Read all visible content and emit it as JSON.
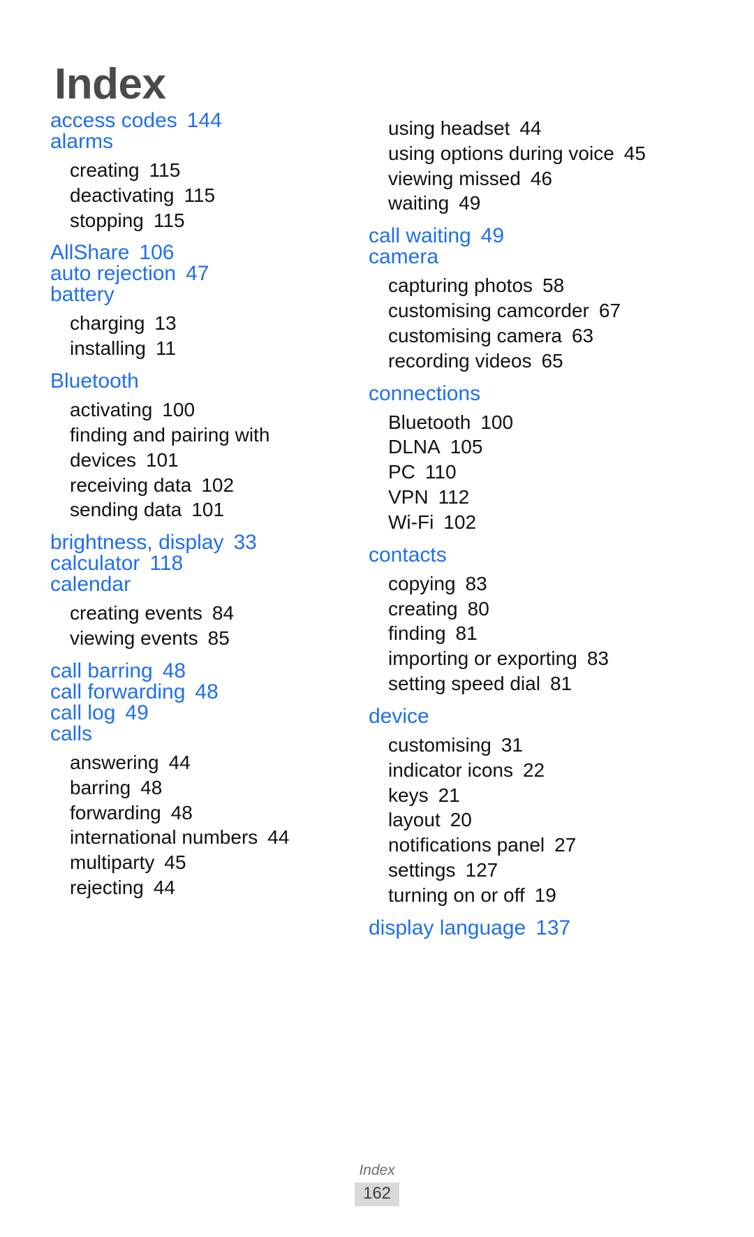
{
  "page": {
    "title": "Index",
    "footer_label": "Index",
    "footer_page_number": "162",
    "accent_color": "#1f6fec",
    "title_color": "#4a4a4a",
    "body_color": "#111111",
    "footer_badge_color": "#d9d9d9"
  },
  "columns": [
    {
      "id": "left",
      "groups": [
        {
          "heading": "access codes",
          "heading_page": "144",
          "subentries": []
        },
        {
          "heading": "alarms",
          "heading_page": "",
          "subentries": [
            {
              "label": "creating",
              "page": "115"
            },
            {
              "label": "deactivating",
              "page": "115"
            },
            {
              "label": "stopping",
              "page": "115"
            }
          ]
        },
        {
          "heading": "AllShare",
          "heading_page": "106",
          "subentries": []
        },
        {
          "heading": "auto rejection",
          "heading_page": "47",
          "subentries": []
        },
        {
          "heading": "battery",
          "heading_page": "",
          "subentries": [
            {
              "label": "charging",
              "page": "13"
            },
            {
              "label": "installing",
              "page": "11"
            }
          ]
        },
        {
          "heading": "Bluetooth",
          "heading_page": "",
          "subentries": [
            {
              "label": "activating",
              "page": "100"
            },
            {
              "label": "finding and pairing with devices",
              "page": "101",
              "wrap": true
            },
            {
              "label": "receiving data",
              "page": "102"
            },
            {
              "label": "sending data",
              "page": "101"
            }
          ]
        },
        {
          "heading": "brightness, display",
          "heading_page": "33",
          "subentries": []
        },
        {
          "heading": "calculator",
          "heading_page": "118",
          "subentries": []
        },
        {
          "heading": "calendar",
          "heading_page": "",
          "subentries": [
            {
              "label": "creating events",
              "page": "84"
            },
            {
              "label": "viewing events",
              "page": "85"
            }
          ]
        },
        {
          "heading": "call barring",
          "heading_page": "48",
          "subentries": []
        },
        {
          "heading": "call forwarding",
          "heading_page": "48",
          "subentries": []
        },
        {
          "heading": "call log",
          "heading_page": "49",
          "subentries": []
        },
        {
          "heading": "calls",
          "heading_page": "",
          "subentries": [
            {
              "label": "answering",
              "page": "44"
            },
            {
              "label": "barring",
              "page": "48"
            },
            {
              "label": "forwarding",
              "page": "48"
            },
            {
              "label": "international numbers",
              "page": "44"
            },
            {
              "label": "multiparty",
              "page": "45"
            },
            {
              "label": "rejecting",
              "page": "44"
            }
          ]
        }
      ]
    },
    {
      "id": "right",
      "groups": [
        {
          "heading": "",
          "heading_page": "",
          "subentries": [
            {
              "label": "using headset",
              "page": "44"
            },
            {
              "label": "using options during voice",
              "page": "45",
              "wrap": true
            },
            {
              "label": "viewing missed",
              "page": "46"
            },
            {
              "label": "waiting",
              "page": "49"
            }
          ]
        },
        {
          "heading": "call waiting",
          "heading_page": "49",
          "subentries": []
        },
        {
          "heading": "camera",
          "heading_page": "",
          "subentries": [
            {
              "label": "capturing photos",
              "page": "58"
            },
            {
              "label": "customising camcorder",
              "page": "67"
            },
            {
              "label": "customising camera",
              "page": "63"
            },
            {
              "label": "recording videos",
              "page": "65"
            }
          ]
        },
        {
          "heading": "connections",
          "heading_page": "",
          "subentries": [
            {
              "label": "Bluetooth",
              "page": "100"
            },
            {
              "label": "DLNA",
              "page": "105"
            },
            {
              "label": "PC",
              "page": "110"
            },
            {
              "label": "VPN",
              "page": "112"
            },
            {
              "label": "Wi-Fi",
              "page": "102"
            }
          ]
        },
        {
          "heading": "contacts",
          "heading_page": "",
          "subentries": [
            {
              "label": "copying",
              "page": "83"
            },
            {
              "label": "creating",
              "page": "80"
            },
            {
              "label": "finding",
              "page": "81"
            },
            {
              "label": "importing or exporting",
              "page": "83"
            },
            {
              "label": "setting speed dial",
              "page": "81"
            }
          ]
        },
        {
          "heading": "device",
          "heading_page": "",
          "subentries": [
            {
              "label": "customising",
              "page": "31"
            },
            {
              "label": "indicator icons",
              "page": "22"
            },
            {
              "label": "keys",
              "page": "21"
            },
            {
              "label": "layout",
              "page": "20"
            },
            {
              "label": "notifications panel",
              "page": "27"
            },
            {
              "label": "settings",
              "page": "127"
            },
            {
              "label": "turning on or off",
              "page": "19"
            }
          ]
        },
        {
          "heading": "display language",
          "heading_page": "137",
          "subentries": []
        }
      ]
    }
  ]
}
